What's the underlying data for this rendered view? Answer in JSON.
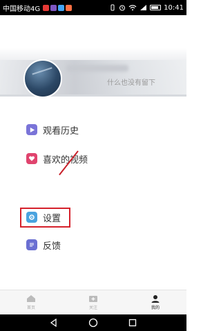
{
  "status_bar": {
    "carrier": "中国移动4G",
    "time": "10:41",
    "app_colors": [
      "#e53935",
      "#7e57c2",
      "#42a5f5",
      "#ff7043"
    ]
  },
  "profile": {
    "signature": "什么也没有留下"
  },
  "menu": {
    "history": "观看历史",
    "liked_videos": "喜欢的视频",
    "settings": "设置",
    "feedback": "反馈"
  },
  "tabbar": {
    "home": "首页",
    "follow": "关注",
    "mine": "我的"
  },
  "colors": {
    "highlight": "#d5202a",
    "history_icon": "#7a74d8",
    "like_icon": "#e0446e",
    "settings_icon": "#4aa3df",
    "feedback_icon": "#6a6fd2"
  }
}
